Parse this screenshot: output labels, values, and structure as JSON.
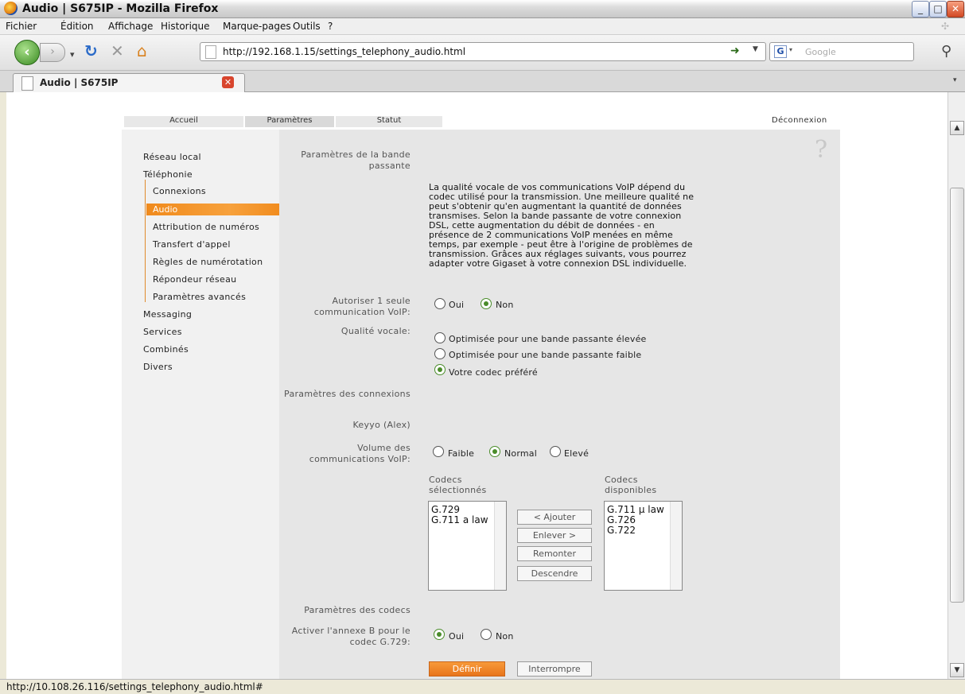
{
  "window": {
    "title": "Audio | S675IP  - Mozilla Firefox"
  },
  "menu": [
    "Fichier",
    "Édition",
    "Affichage",
    "Historique",
    "Marque-pages",
    "Outils",
    "?"
  ],
  "navbar": {
    "url": "http://192.168.1.15/settings_telephony_audio.html",
    "search_placeholder": "Google"
  },
  "tab": {
    "label": "Audio | S675IP"
  },
  "page": {
    "top_tabs": [
      "Accueil",
      "Paramètres",
      "Statut"
    ],
    "logout": "Déconnexion",
    "help_icon": "?",
    "sidebar": {
      "items": [
        "Réseau local",
        "Téléphonie",
        "Connexions",
        "Audio",
        "Attribution de numéros",
        "Transfert d'appel",
        "Règles de numérotation",
        "Répondeur réseau",
        "Paramètres avancés",
        "Messaging",
        "Services",
        "Combinés",
        "Divers"
      ]
    },
    "bandwidth": {
      "heading": "Paramètres de la bande passante",
      "description": [
        "La qualité vocale de vos communications VoIP dépend du",
        "codec utilisé pour la transmission. Une meilleure qualité ne",
        "peut s'obtenir qu'en augmentant la quantité de données",
        "transmises. Selon la bande passante de votre connexion",
        "DSL, cette augmentation du débit de données - en",
        "présence de 2 communications VoIP menées en même",
        "temps, par exemple - peut être à l'origine de problèmes de",
        "transmission. Grâces aux réglages suivants, vous pourrez",
        "adapter votre Gigaset à votre connexion DSL individuelle."
      ],
      "single_voip_label": "Autoriser 1 seule communication VoIP:",
      "yes": "Oui",
      "no": "Non",
      "single_voip_value": "Non",
      "quality_label": "Qualité vocale:",
      "quality_options": [
        "Optimisée pour une bande passante élevée",
        "Optimisée pour une bande passante faible",
        "Votre codec préféré"
      ],
      "quality_selected": "Votre codec préféré"
    },
    "connections": {
      "heading": "Paramètres des connexions",
      "connection_name": "Keyyo (Alex)",
      "volume_label": "Volume des communications VoIP:",
      "volume_options": [
        "Faible",
        "Normal",
        "Elevé"
      ],
      "volume_selected": "Normal",
      "selected_codecs_label": "Codecs sélectionnés",
      "available_codecs_label": "Codecs disponibles",
      "selected_codecs": [
        "G.729",
        "G.711 a law"
      ],
      "available_codecs": [
        "G.711 µ law",
        "G.726",
        "G.722"
      ],
      "buttons": {
        "add": "< Ajouter",
        "remove": "Enlever >",
        "up": "Remonter",
        "down": "Descendre"
      }
    },
    "codecs": {
      "heading": "Paramètres des codecs",
      "annex_b_label": "Activer l'annexe B pour le codec G.729:",
      "annex_b_value": "Oui"
    },
    "actions": {
      "apply": "Définir",
      "cancel": "Interrompre"
    }
  },
  "status": {
    "text": "http://10.108.26.116/settings_telephony_audio.html#"
  }
}
